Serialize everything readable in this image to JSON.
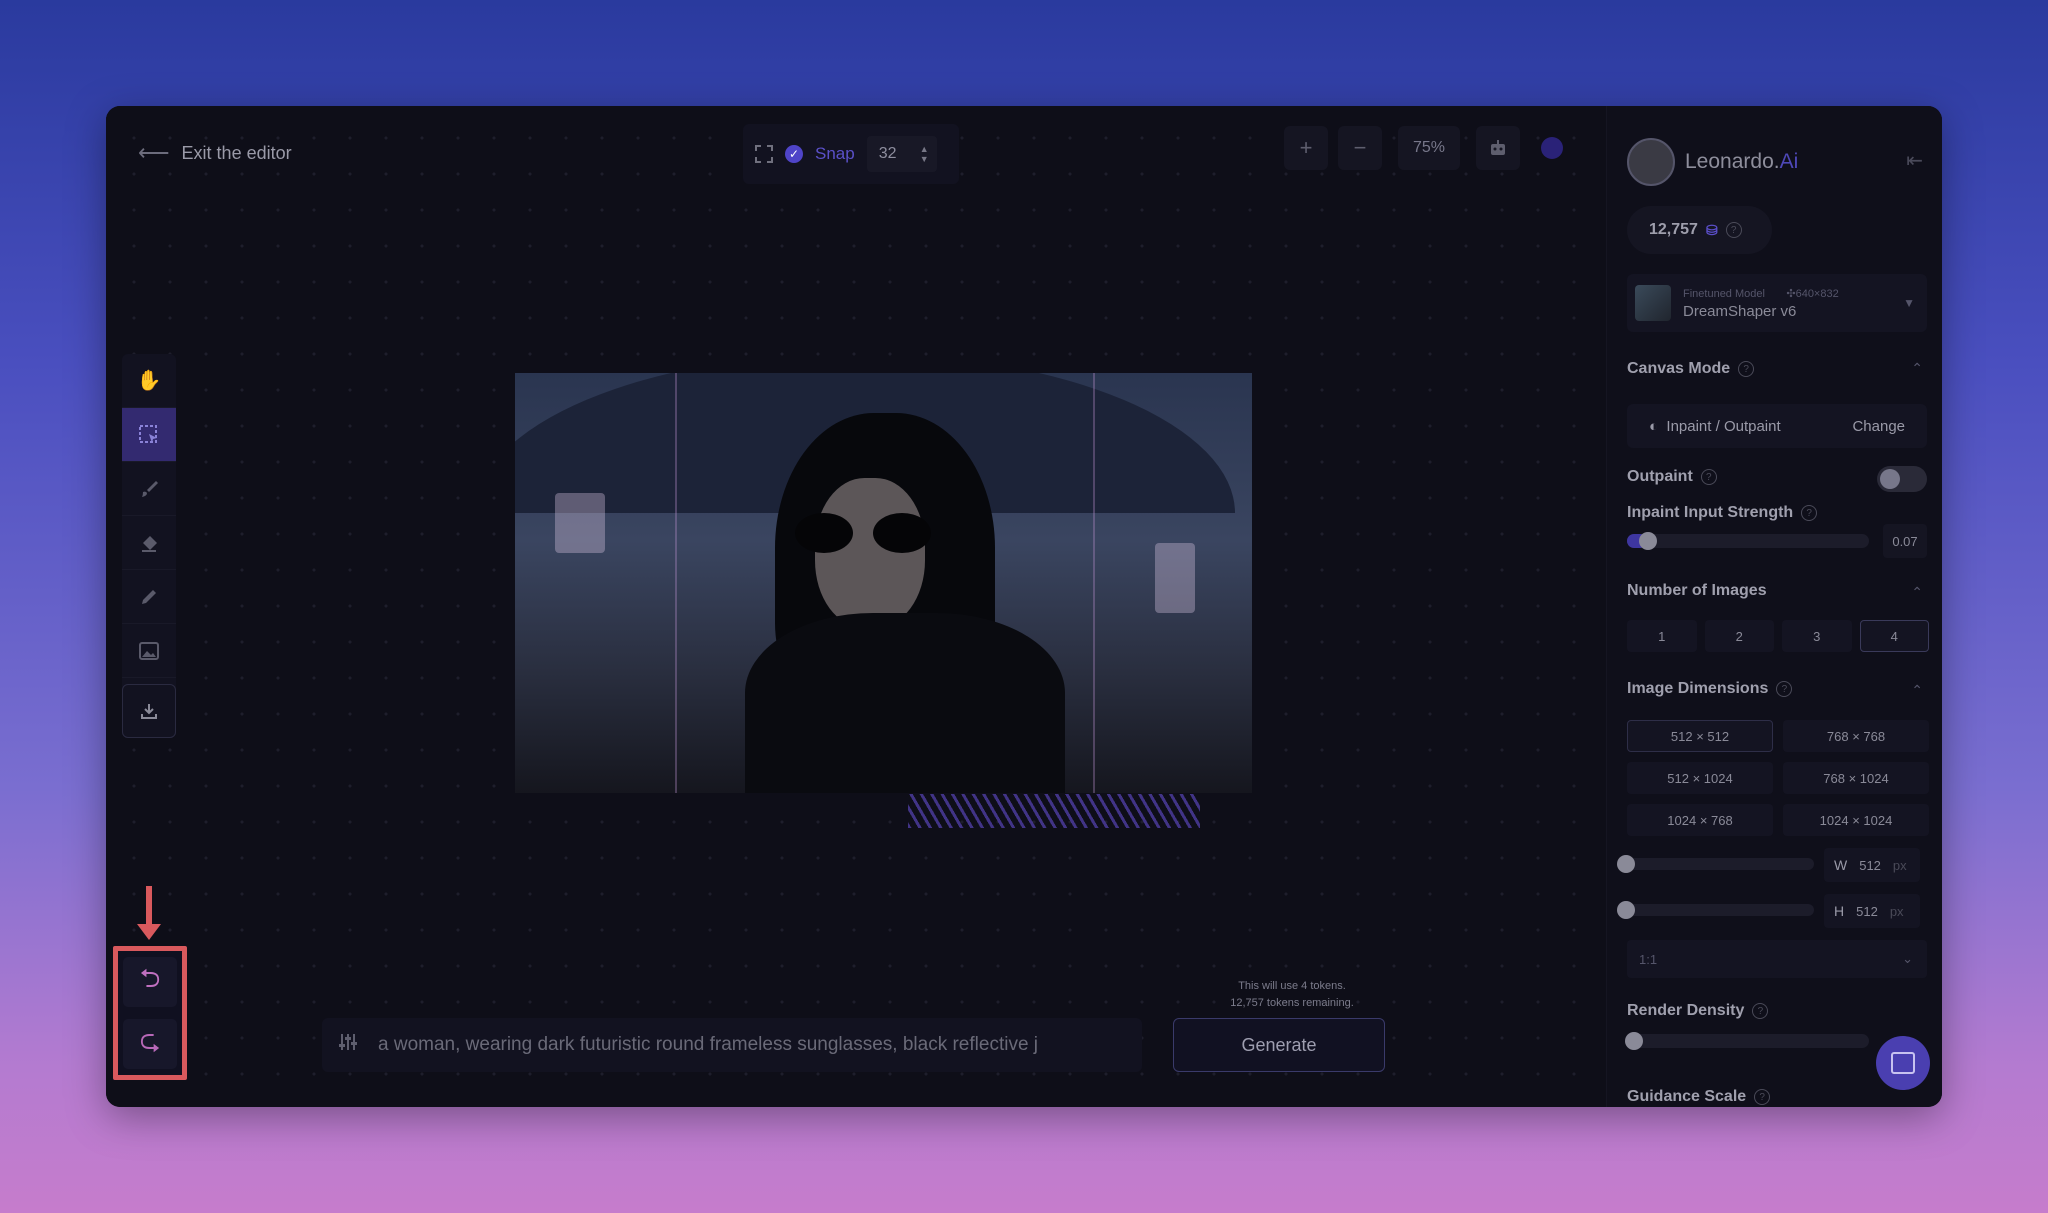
{
  "header": {
    "exit_label": "Exit the editor",
    "snap_label": "Snap",
    "snap_value": "32",
    "zoom_in": "+",
    "zoom_out": "−",
    "zoom_level": "75%"
  },
  "toolbar": {
    "tools": [
      "pan-icon",
      "select-icon",
      "brush-icon",
      "eraser-icon",
      "pencil-icon",
      "image-icon",
      "download-icon"
    ]
  },
  "history": {
    "undo": "undo",
    "redo": "redo"
  },
  "prompt": {
    "text": "a woman, wearing dark futuristic round frameless sunglasses, black reflective j",
    "token_line1": "This will use 4 tokens.",
    "token_line2": "12,757 tokens remaining.",
    "generate_label": "Generate"
  },
  "sidebar": {
    "brand": "Leonardo.",
    "brand_ai": "Ai",
    "tokens": "12,757",
    "model_kicker": "Finetuned Model",
    "model_dims": "640×832",
    "model_name": "DreamShaper v6",
    "canvas_mode_title": "Canvas Mode",
    "canvas_mode_value": "Inpaint / Outpaint",
    "canvas_mode_change": "Change",
    "outpaint_label": "Outpaint",
    "inpaint_strength_label": "Inpaint Input Strength",
    "inpaint_strength_value": "0.07",
    "num_images_title": "Number of Images",
    "num_images_options": [
      "1",
      "2",
      "3",
      "4"
    ],
    "num_images_selected": "4",
    "dimensions_title": "Image Dimensions",
    "dimensions_options": [
      "512 × 512",
      "768 × 768",
      "512 × 1024",
      "768 × 1024",
      "1024 × 768",
      "1024 × 1024"
    ],
    "dimensions_selected": "512 × 512",
    "width_key": "W",
    "width_value": "512",
    "height_key": "H",
    "height_value": "512",
    "px_unit": "px",
    "aspect_ratio": "1:1",
    "render_density_title": "Render Density",
    "guidance_scale_title": "Guidance Scale"
  },
  "colors": {
    "accent": "#4f44c8",
    "highlight_annotation": "#d9595d"
  }
}
